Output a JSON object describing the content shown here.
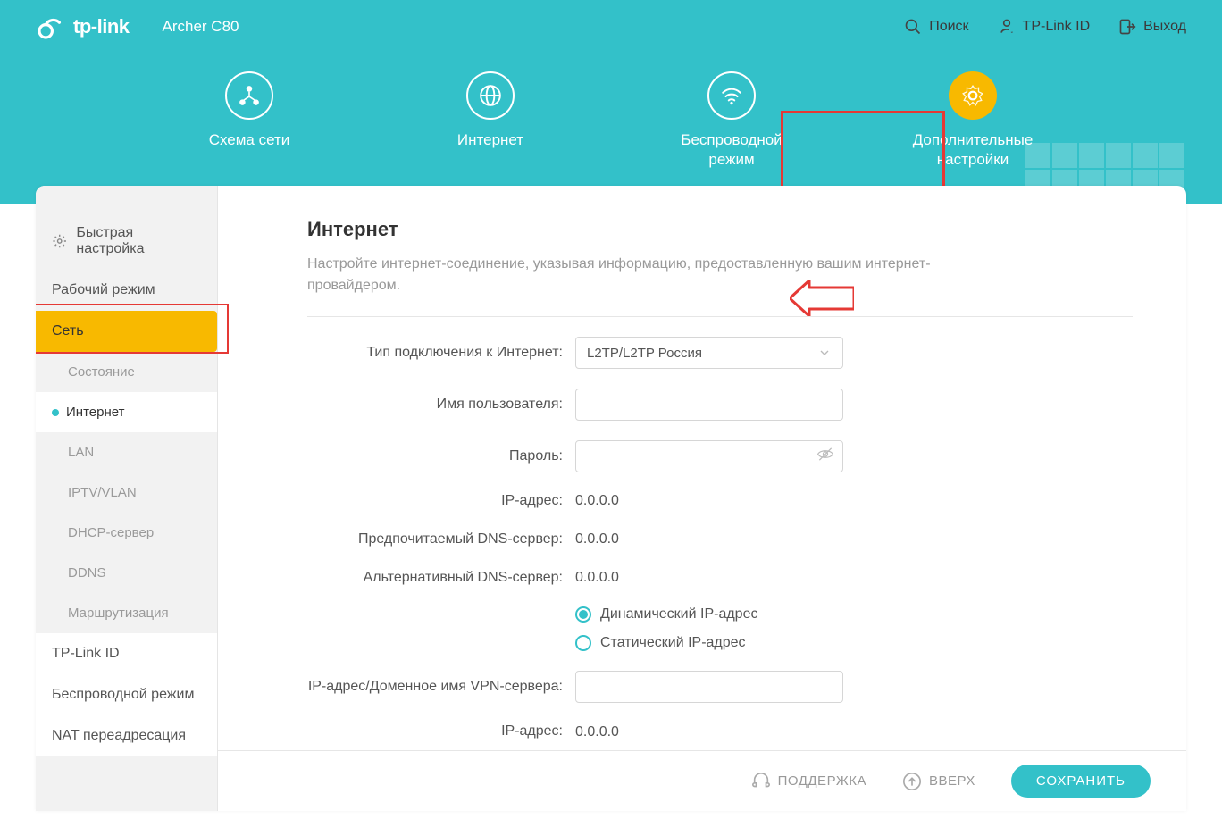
{
  "header": {
    "brand": "tp-link",
    "model": "Archer C80",
    "actions": {
      "search": "Поиск",
      "tplink_id": "TP-Link ID",
      "logout": "Выход"
    }
  },
  "tabs": {
    "network_map": "Схема сети",
    "internet": "Интернет",
    "wireless": "Беспроводной режим",
    "advanced": "Дополнительные настройки"
  },
  "sidebar": {
    "quick_setup": "Быстрая настройка",
    "operation_mode": "Рабочий режим",
    "network": "Сеть",
    "sub": {
      "status": "Состояние",
      "internet": "Интернет",
      "lan": "LAN",
      "iptv": "IPTV/VLAN",
      "dhcp": "DHCP-сервер",
      "ddns": "DDNS",
      "routing": "Маршрутизация"
    },
    "tplink_id": "TP-Link ID",
    "wireless": "Беспроводной режим",
    "nat": "NAT переадресация"
  },
  "content": {
    "title": "Интернет",
    "description": "Настройте интернет-соединение, указывая информацию, предоставленную вашим интернет-провайдером.",
    "labels": {
      "conn_type": "Тип подключения к Интернет:",
      "username": "Имя пользователя:",
      "password": "Пароль:",
      "ip": "IP-адрес:",
      "dns1": "Предпочитаемый DNS-сервер:",
      "dns2": "Альтернативный DNS-сервер:",
      "vpn_server": "IP-адрес/Доменное имя VPN-сервера:",
      "ip2": "IP-адрес:"
    },
    "values": {
      "conn_type": "L2TP/L2TP Россия",
      "username": "",
      "password": "",
      "ip": "0.0.0.0",
      "dns1": "0.0.0.0",
      "dns2": "0.0.0.0",
      "vpn_server": "",
      "ip2": "0.0.0.0"
    },
    "radio": {
      "dynamic": "Динамический IP-адрес",
      "static": "Статический IP-адрес"
    }
  },
  "footer": {
    "support": "ПОДДЕРЖКА",
    "top": "ВВЕРХ",
    "save": "СОХРАНИТЬ"
  }
}
